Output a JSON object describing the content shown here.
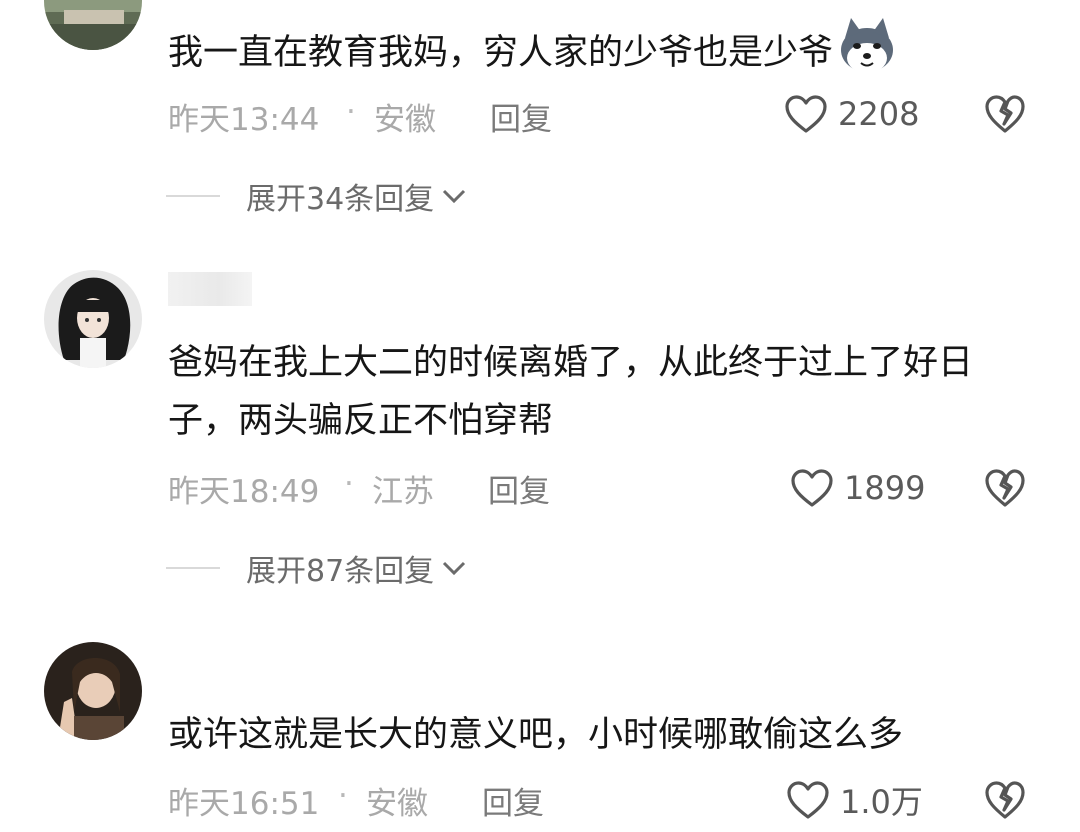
{
  "comments": [
    {
      "text": "我一直在教育我妈，穷人家的少爷也是少爷",
      "time": "昨天13:44",
      "location": "安徽",
      "reply_label": "回复",
      "likes": "2208",
      "expand_label": "展开34条回复",
      "emoji": "husky-dog-emoji"
    },
    {
      "username": "",
      "text": "爸妈在我上大二的时候离婚了，从此终于过上了好日子，两头骗反正不怕穿帮",
      "time": "昨天18:49",
      "location": "江苏",
      "reply_label": "回复",
      "likes": "1899",
      "expand_label": "展开87条回复"
    },
    {
      "text": "或许这就是长大的意义吧，小时候哪敢偷这么多",
      "time": "昨天16:51",
      "location": "安徽",
      "reply_label": "回复",
      "likes": "1.0万"
    }
  ],
  "separator": "·",
  "icons": {
    "like": "heart-outline-icon",
    "dislike": "broken-heart-icon",
    "expand": "chevron-down-icon"
  }
}
